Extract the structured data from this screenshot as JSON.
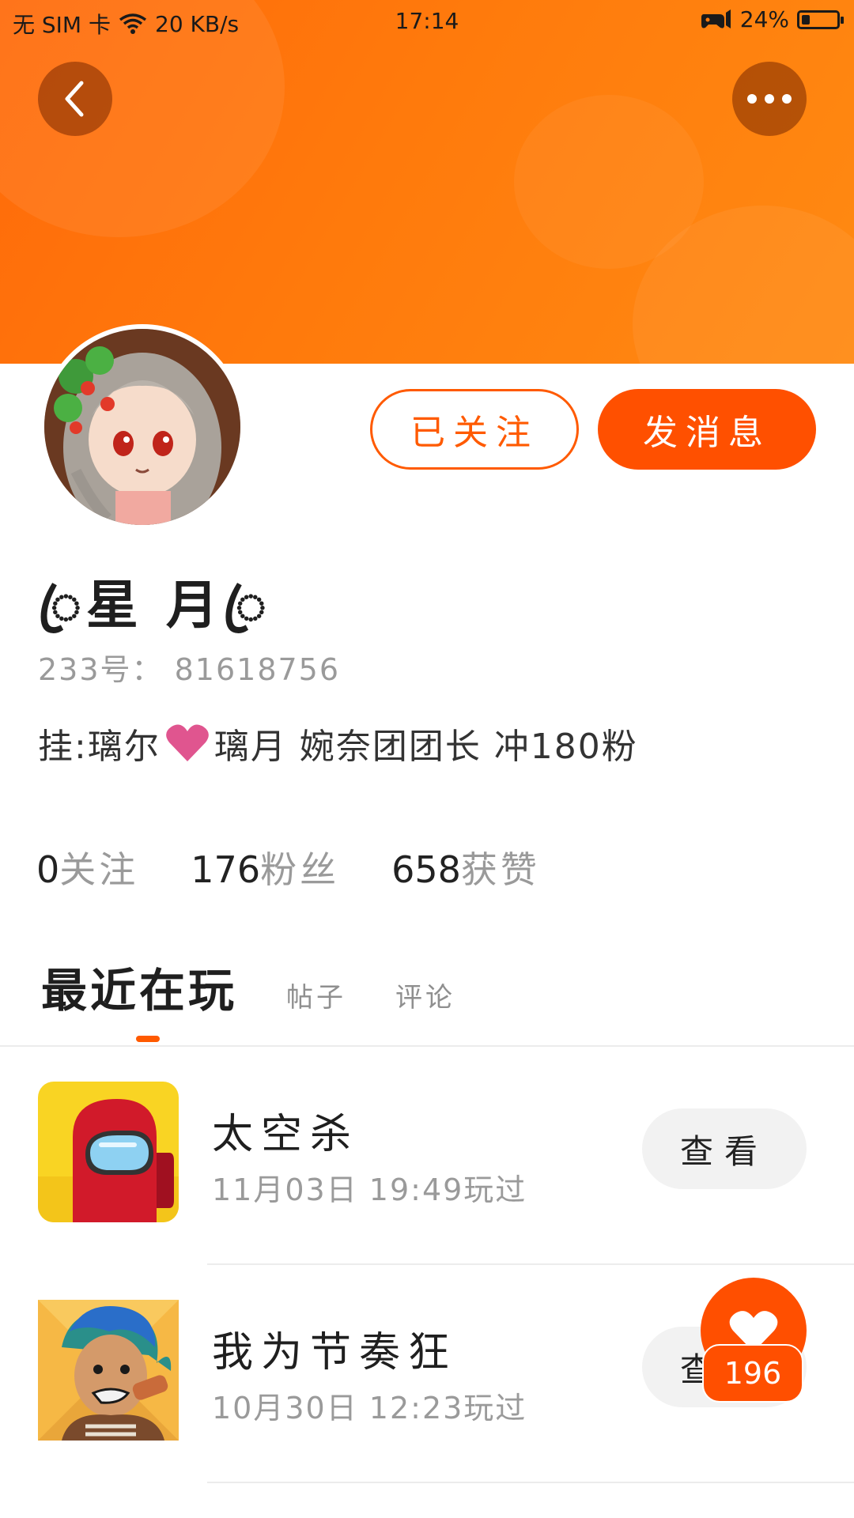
{
  "status_bar": {
    "sim": "无 SIM 卡",
    "network_speed": "20 KB/s",
    "time": "17:14",
    "battery": "24%",
    "battery_level": 0.24
  },
  "header": {
    "back_icon": "chevron-left-icon",
    "more_icon": "more-dots-icon"
  },
  "profile": {
    "nickname": "ꦿ星 月ꦿ",
    "uid_label": "233号：",
    "uid_value": "81618756",
    "bio_prefix": "挂:璃尔",
    "bio_suffix": "璃月  婉奈团团长  冲180粉",
    "bio_heart_color": "#e0558f",
    "follow_state_label": "已关注",
    "message_label": "发消息"
  },
  "stats": [
    {
      "value": "0",
      "label": "关注"
    },
    {
      "value": "176",
      "label": "粉丝"
    },
    {
      "value": "658",
      "label": "获赞"
    }
  ],
  "tabs": [
    {
      "label": "最近在玩",
      "active": true
    },
    {
      "label": "帖子",
      "active": false
    },
    {
      "label": "评论",
      "active": false
    }
  ],
  "games": [
    {
      "name": "太空杀",
      "played": "11月03日 19:49玩过",
      "action": "查看",
      "icon": "among-us-crewmate-icon"
    },
    {
      "name": "我为节奏狂",
      "played": "10月30日 12:23玩过",
      "action": "查看",
      "icon": "rhythm-game-character-icon"
    }
  ],
  "floating_like": {
    "count": "196",
    "icon": "heart-icon"
  },
  "colors": {
    "accent": "#ff5000",
    "banner": "#ff7a0c",
    "muted_text": "#9a9a9a"
  }
}
